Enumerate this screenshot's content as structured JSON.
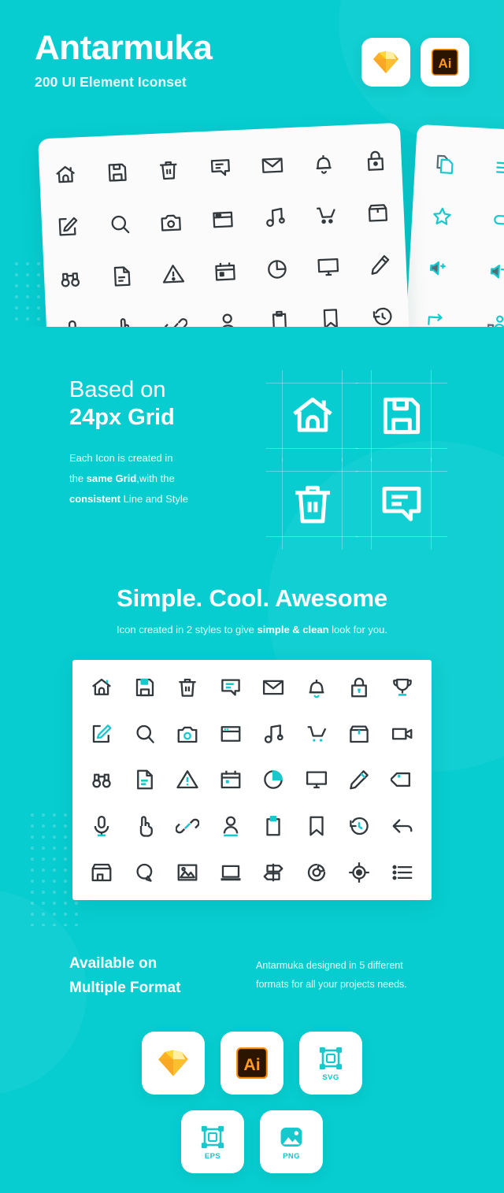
{
  "colors": {
    "background": "#07cdd0",
    "accent_teal": "#17c8cd",
    "icon_dark": "#32383c",
    "card_white": "#ffffff",
    "sketch_gold": "#f7b500",
    "illustrator_orange": "#ff7c00",
    "illustrator_dark": "#2b1400"
  },
  "header": {
    "title": "Antarmuka",
    "subtitle": "200 UI Element Iconset",
    "badges": [
      {
        "name": "sketch-badge",
        "label": "Sketch"
      },
      {
        "name": "illustrator-badge",
        "label": "Ai"
      }
    ]
  },
  "preview_cards": {
    "left_card_icons": [
      "home-icon",
      "save-floppy-icon",
      "trash-icon",
      "chat-bubble-icon",
      "mail-envelope-icon",
      "bell-icon",
      "lock-icon",
      "edit-square-icon",
      "search-icon",
      "camera-icon",
      "browser-window-icon",
      "music-note-icon",
      "shopping-cart-icon",
      "box-icon",
      "binoculars-icon",
      "document-icon",
      "warning-triangle-icon",
      "calendar-icon",
      "pie-chart-icon",
      "monitor-icon",
      "pencil-icon",
      "microphone-icon",
      "pointing-hand-icon",
      "link-icon",
      "user-icon",
      "clipboard-icon",
      "bookmark-icon",
      "history-undo-icon"
    ],
    "right_card_icons": [
      "copy-files-icon",
      "hamburger-menu-icon",
      "star-icon",
      "toggle-switch-icon",
      "volume-up-icon",
      "volume-down-icon",
      "forward-arrow-icon",
      "add-user-icon"
    ]
  },
  "grid_section": {
    "heading_line1": "Based on",
    "heading_line2": "24px Grid",
    "body_line1": "Each Icon is created in",
    "body_line2_pre": "the ",
    "body_line2_bold": "same Grid",
    "body_line2_post": ",with the",
    "body_line3_bold": "consistent",
    "body_line3_post": " Line and Style",
    "icons": [
      "home-icon",
      "save-floppy-icon",
      "trash-icon",
      "chat-bubble-icon"
    ]
  },
  "styles_section": {
    "title": "Simple. Cool. Awesome",
    "sub_pre": "Icon created in 2 styles to give ",
    "sub_bold": "simple & clean",
    "sub_post": " look for you.",
    "panel_icons": [
      "home-icon",
      "save-floppy-icon",
      "trash-icon",
      "chat-bubble-icon",
      "mail-envelope-icon",
      "bell-icon",
      "lock-icon",
      "trophy-icon",
      "edit-square-icon",
      "search-icon",
      "camera-icon",
      "browser-window-icon",
      "music-note-icon",
      "shopping-cart-icon",
      "box-icon",
      "video-camera-icon",
      "binoculars-icon",
      "document-icon",
      "warning-triangle-icon",
      "calendar-icon",
      "pie-chart-icon",
      "monitor-icon",
      "pencil-icon",
      "price-tag-icon",
      "microphone-icon",
      "pointing-hand-icon",
      "link-icon",
      "user-icon",
      "clipboard-icon",
      "bookmark-icon",
      "history-undo-icon",
      "reply-arrow-icon",
      "store-icon",
      "search-bubble-icon",
      "image-icon",
      "laptop-icon",
      "signpost-icon",
      "donut-chart-icon",
      "target-icon",
      "list-icon"
    ]
  },
  "formats_section": {
    "heading_line1": "Available on",
    "heading_line2": "Multiple Format",
    "body_line1": "Antarmuka designed in 5 different",
    "body_line2": "formats for all your projects needs.",
    "badges_row1": [
      {
        "name": "sketch-format-badge",
        "label": ""
      },
      {
        "name": "illustrator-format-badge",
        "label": ""
      },
      {
        "name": "svg-format-badge",
        "label": "SVG"
      }
    ],
    "badges_row2": [
      {
        "name": "eps-format-badge",
        "label": "EPS"
      },
      {
        "name": "png-format-badge",
        "label": "PNG"
      }
    ]
  }
}
